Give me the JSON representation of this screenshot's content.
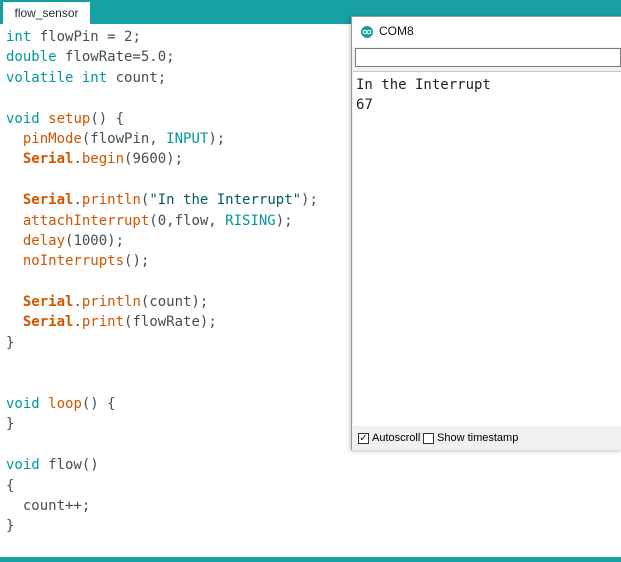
{
  "editor": {
    "tab_label": "flow_sensor",
    "lines": [
      [
        {
          "t": "int",
          "c": "kw"
        },
        {
          "t": " flowPin = 2;",
          "c": "plain"
        }
      ],
      [
        {
          "t": "double",
          "c": "kw"
        },
        {
          "t": " flowRate=5.0;",
          "c": "plain"
        }
      ],
      [
        {
          "t": "volatile",
          "c": "kw"
        },
        {
          "t": " ",
          "c": "plain"
        },
        {
          "t": "int",
          "c": "kw"
        },
        {
          "t": " count;",
          "c": "plain"
        }
      ],
      [],
      [
        {
          "t": "void",
          "c": "kw"
        },
        {
          "t": " ",
          "c": "plain"
        },
        {
          "t": "setup",
          "c": "fn"
        },
        {
          "t": "() {",
          "c": "plain"
        }
      ],
      [
        {
          "t": "  ",
          "c": "plain"
        },
        {
          "t": "pinMode",
          "c": "fn"
        },
        {
          "t": "(flowPin, ",
          "c": "plain"
        },
        {
          "t": "INPUT",
          "c": "const"
        },
        {
          "t": ");",
          "c": "plain"
        }
      ],
      [
        {
          "t": "  ",
          "c": "plain"
        },
        {
          "t": "Serial",
          "c": "cls"
        },
        {
          "t": ".",
          "c": "plain"
        },
        {
          "t": "begin",
          "c": "fn"
        },
        {
          "t": "(9600);",
          "c": "plain"
        }
      ],
      [],
      [
        {
          "t": "  ",
          "c": "plain"
        },
        {
          "t": "Serial",
          "c": "cls"
        },
        {
          "t": ".",
          "c": "plain"
        },
        {
          "t": "println",
          "c": "fn"
        },
        {
          "t": "(",
          "c": "plain"
        },
        {
          "t": "\"In the Interrupt\"",
          "c": "str"
        },
        {
          "t": ");",
          "c": "plain"
        }
      ],
      [
        {
          "t": "  ",
          "c": "plain"
        },
        {
          "t": "attachInterrupt",
          "c": "fn"
        },
        {
          "t": "(0,flow, ",
          "c": "plain"
        },
        {
          "t": "RISING",
          "c": "const"
        },
        {
          "t": ");",
          "c": "plain"
        }
      ],
      [
        {
          "t": "  ",
          "c": "plain"
        },
        {
          "t": "delay",
          "c": "fn"
        },
        {
          "t": "(1000);",
          "c": "plain"
        }
      ],
      [
        {
          "t": "  ",
          "c": "plain"
        },
        {
          "t": "noInterrupts",
          "c": "fn"
        },
        {
          "t": "();",
          "c": "plain"
        }
      ],
      [],
      [
        {
          "t": "  ",
          "c": "plain"
        },
        {
          "t": "Serial",
          "c": "cls"
        },
        {
          "t": ".",
          "c": "plain"
        },
        {
          "t": "println",
          "c": "fn"
        },
        {
          "t": "(count);",
          "c": "plain"
        }
      ],
      [
        {
          "t": "  ",
          "c": "plain"
        },
        {
          "t": "Serial",
          "c": "cls"
        },
        {
          "t": ".",
          "c": "plain"
        },
        {
          "t": "print",
          "c": "fn"
        },
        {
          "t": "(flowRate);",
          "c": "plain"
        }
      ],
      [
        {
          "t": "}",
          "c": "plain"
        }
      ],
      [],
      [],
      [
        {
          "t": "void",
          "c": "kw"
        },
        {
          "t": " ",
          "c": "plain"
        },
        {
          "t": "loop",
          "c": "fn"
        },
        {
          "t": "() {",
          "c": "plain"
        }
      ],
      [
        {
          "t": "}",
          "c": "plain"
        }
      ],
      [],
      [
        {
          "t": "void",
          "c": "kw"
        },
        {
          "t": " flow()",
          "c": "plain"
        }
      ],
      [
        {
          "t": "{",
          "c": "plain"
        }
      ],
      [
        {
          "t": "  count++;",
          "c": "plain"
        }
      ],
      [
        {
          "t": "}",
          "c": "plain"
        }
      ]
    ]
  },
  "serial_monitor": {
    "title": "COM8",
    "send_input_value": "",
    "output_lines": [
      "In the Interrupt",
      "67"
    ],
    "autoscroll_label": "Autoscroll",
    "autoscroll_checked": true,
    "show_timestamp_label": "Show timestamp",
    "show_timestamp_checked": false
  },
  "colors": {
    "accent_teal": "#17a1a5",
    "keyword": "#00979c",
    "function": "#d35400"
  },
  "icons": {
    "monitor_app_icon": "arduino-icon"
  }
}
